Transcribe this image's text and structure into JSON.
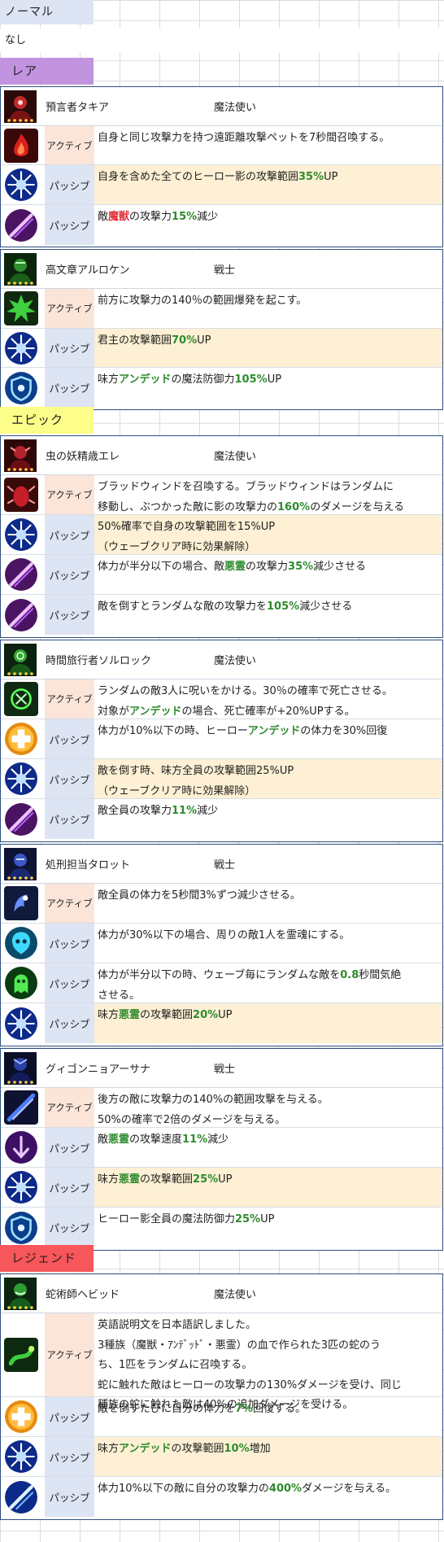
{
  "normal_header": "ノーマル",
  "normal_value": "なし",
  "sections": [
    {
      "label": "レア",
      "color": "#c294e0",
      "heroes": [
        {
          "name": "預言者タキア",
          "cls": "魔法使い",
          "icon": "prophet-portrait-icon",
          "skills": [
            {
              "type": "アクティブ",
              "icon": "red-flame-icon",
              "parts": [
                "自身と同じ攻撃力を持つ遠距離攻撃ペットを7秒間召喚する。"
              ]
            },
            {
              "type": "パッシブ",
              "icon": "blue-burst-icon",
              "hl": true,
              "parts": [
                "自身を含めた全てのヒーロー影の攻撃範囲",
                "35%",
                "UP"
              ]
            },
            {
              "type": "パッシブ",
              "icon": "purple-slash-icon",
              "parts": [
                "敵",
                "魔獣",
                "の攻撃力",
                "15%",
                "減少"
              ]
            }
          ]
        },
        {
          "name": "高文章アルロケン",
          "cls": "戦士",
          "icon": "green-warrior-portrait-icon",
          "skills": [
            {
              "type": "アクティブ",
              "icon": "green-explosion-icon",
              "parts": [
                "前方に攻撃力の140％の範囲爆発を起こす。"
              ]
            },
            {
              "type": "パッシブ",
              "icon": "blue-burst-icon",
              "hl": true,
              "parts": [
                "君主の攻撃範囲",
                "70%",
                "UP"
              ]
            },
            {
              "type": "パッシブ",
              "icon": "blue-shield-icon",
              "parts": [
                "味方",
                "アンデッド",
                "の魔法防御力",
                "105%",
                "UP"
              ]
            }
          ]
        }
      ]
    },
    {
      "label": "エピック",
      "color": "#fdfd8a",
      "heroes": [
        {
          "name": "虫の妖精歳エレ",
          "cls": "魔法使い",
          "icon": "insect-fairy-portrait-icon",
          "skills": [
            {
              "type": "アクティブ",
              "icon": "red-bug-icon",
              "parts": [
                "ブラッドウィンドを召喚する。ブラッドウィンドはランダムに\n移動し、ぶつかった敵に影の攻撃力の",
                "160%",
                "のダメージを与える"
              ]
            },
            {
              "type": "パッシブ",
              "icon": "blue-burst-icon",
              "hl": true,
              "parts": [
                "50%確率で自身の攻撃範囲を15%UP\n（ウェーブクリア時に効果解除）"
              ]
            },
            {
              "type": "パッシブ",
              "icon": "purple-slash-icon",
              "parts": [
                "体力が半分以下の場合、敵",
                "悪霊",
                "の攻撃力",
                "35%",
                "減少させる"
              ]
            },
            {
              "type": "パッシブ",
              "icon": "purple-slash-icon",
              "parts": [
                "敵を倒すとランダムな敵の攻撃力を",
                "105%",
                "減少させる"
              ]
            }
          ]
        },
        {
          "name": "時間旅行者ソルロック",
          "cls": "魔法使い",
          "icon": "time-traveler-portrait-icon",
          "skills": [
            {
              "type": "アクティブ",
              "icon": "green-curse-icon",
              "parts": [
                "ランダムの敵3人に呪いをかける。30％の確率で死亡させる。\n対象が",
                "アンデッド",
                "の場合、死亡確率が+20%UPする。"
              ]
            },
            {
              "type": "パッシブ",
              "icon": "gold-cross-icon",
              "parts": [
                "体力が10%以下の時、ヒーロー",
                "アンデッド",
                "の体力を30%回復"
              ]
            },
            {
              "type": "パッシブ",
              "icon": "blue-burst-icon",
              "hl": true,
              "parts": [
                "敵を倒す時、味方全員の攻撃範囲25%UP\n（ウェーブクリア時に効果解除）"
              ]
            },
            {
              "type": "パッシブ",
              "icon": "purple-slash-icon",
              "parts": [
                "敵全員の攻撃力",
                "11%",
                "減少"
              ]
            }
          ]
        },
        {
          "name": "処刑担当タロット",
          "cls": "戦士",
          "icon": "executioner-portrait-icon",
          "skills": [
            {
              "type": "アクティブ",
              "icon": "blue-reaper-icon",
              "parts": [
                "敵全員の体力を5秒間3%ずつ減少させる。"
              ]
            },
            {
              "type": "パッシブ",
              "icon": "cyan-spirit-icon",
              "parts": [
                "体力が30%以下の場合、周りの敵1人を霊魂にする。"
              ]
            },
            {
              "type": "パッシブ",
              "icon": "green-ghost-icon",
              "parts": [
                "体力が半分以下の時、ウェーブ毎にランダムな敵を",
                "0.8",
                "秒間気絶\nさせる。"
              ]
            },
            {
              "type": "パッシブ",
              "icon": "blue-burst-icon",
              "hl": true,
              "parts": [
                "味方",
                "悪霊",
                "の攻撃範囲",
                "20%",
                "UP"
              ]
            }
          ]
        },
        {
          "name": "グィゴンニョアーサナ",
          "cls": "戦士",
          "icon": "dark-knight-portrait-icon",
          "skills": [
            {
              "type": "アクティブ",
              "icon": "dark-knight-skill-icon",
              "parts": [
                "後方の敵に攻撃力の140%の範囲攻撃を与える。\n50%の確率で2倍のダメージを与える。"
              ]
            },
            {
              "type": "パッシブ",
              "icon": "purple-arrow-icon",
              "parts": [
                "敵",
                "悪霊",
                "の攻撃速度",
                "11%",
                "減少"
              ]
            },
            {
              "type": "パッシブ",
              "icon": "blue-burst-icon",
              "hl": true,
              "parts": [
                "味方",
                "悪霊",
                "の攻撃範囲",
                "25%",
                "UP"
              ]
            },
            {
              "type": "パッシブ",
              "icon": "blue-shield-icon",
              "parts": [
                "ヒーロー影全員の魔法防御力",
                "25%",
                "UP"
              ]
            }
          ]
        }
      ]
    },
    {
      "label": "レジェンド",
      "color": "#f7565a",
      "heroes": [
        {
          "name": "蛇術師ヘビッド",
          "cls": "魔法使い",
          "icon": "snake-charmer-portrait-icon",
          "skills": [
            {
              "type": "アクティブ",
              "icon": "snake-summon-icon",
              "parts": [
                "英語説明文を日本語訳しました。\n3種族（魔獣・ｱﾝﾃﾞｯﾄﾞ・悪霊）の血で作られた3匹の蛇のう\nち、1匹をランダムに召喚する。\n蛇に触れた敵はヒーローの攻撃力の130%ダメージを受け、同じ\n種族の蛇に触れた敵は40%の追加ダメージを受ける。"
              ]
            },
            {
              "type": "パッシブ",
              "icon": "gold-cross-icon",
              "parts": [
                "敵を倒すたびに自分の体力を",
                "7%",
                "回復する。"
              ]
            },
            {
              "type": "パッシブ",
              "icon": "blue-burst-icon",
              "hl": true,
              "parts": [
                "味方",
                "アンデッド",
                "の攻撃範囲",
                "10%",
                "増加"
              ]
            },
            {
              "type": "パッシブ",
              "icon": "blue-slash-icon",
              "parts": [
                "体力10%以下の敵に自分の攻撃力の",
                "400%",
                "ダメージを与える。"
              ]
            }
          ]
        }
      ]
    }
  ]
}
